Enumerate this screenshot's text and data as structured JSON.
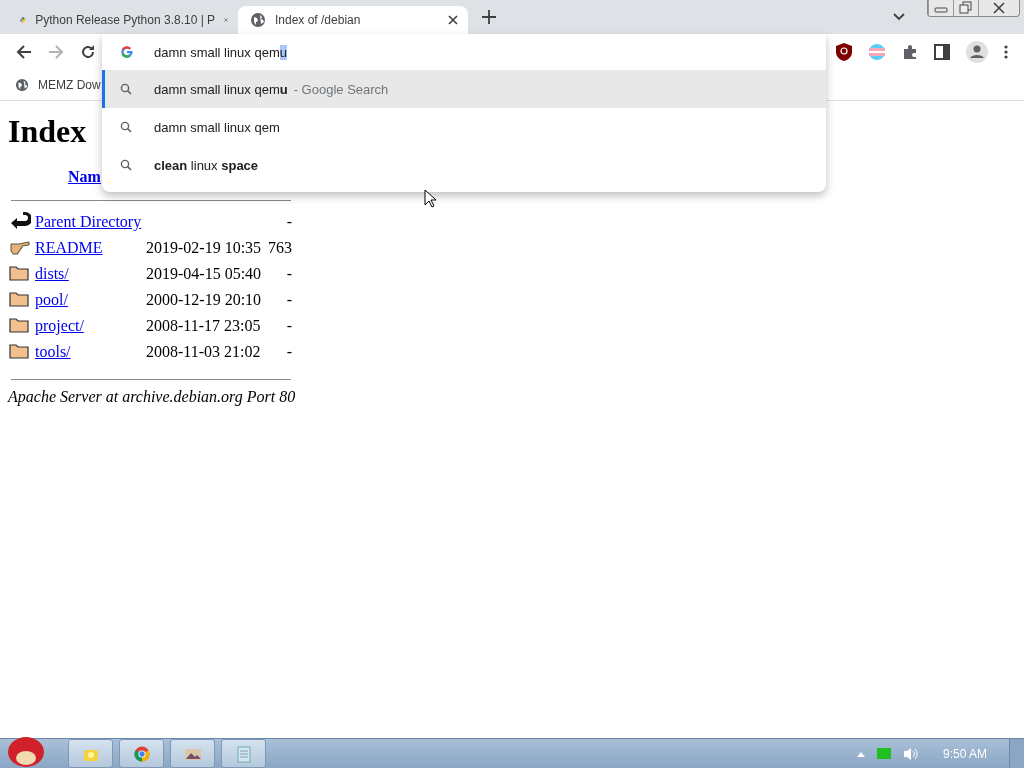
{
  "tabs": [
    {
      "title": "Python Release Python 3.8.10 | P",
      "kind": "python",
      "selected": false
    },
    {
      "title": "Index of /debian",
      "kind": "globe",
      "selected": true
    }
  ],
  "omnibox": {
    "value": "damn small linux qem",
    "autocomplete": "u"
  },
  "suggestions": [
    {
      "text": "damn small linux qem**u**",
      "suffix": "- Google Search",
      "selected": true
    },
    {
      "text": "damn small linux qem",
      "selected": false
    },
    {
      "text": "**clean** linux **space**",
      "selected": false
    }
  ],
  "bookmarks": [
    {
      "title": "MEMZ Dow"
    }
  ],
  "page": {
    "heading": "Index",
    "name_header": "Nam",
    "rows": [
      {
        "kind": "parent",
        "name": "Parent Directory",
        "date": "",
        "size": "-"
      },
      {
        "kind": "file",
        "name": "README",
        "date": "2019-02-19 10:35",
        "size": "763"
      },
      {
        "kind": "folder",
        "name": "dists/",
        "date": "2019-04-15 05:40",
        "size": "-"
      },
      {
        "kind": "folder",
        "name": "pool/",
        "date": "2000-12-19 20:10",
        "size": "-"
      },
      {
        "kind": "folder",
        "name": "project/",
        "date": "2008-11-17 23:05",
        "size": "-"
      },
      {
        "kind": "folder",
        "name": "tools/",
        "date": "2008-11-03 21:02",
        "size": "-"
      }
    ],
    "footer": "Apache Server at archive.debian.org Port 80"
  },
  "taskbar": {
    "apps": [
      {
        "kind": "notes"
      },
      {
        "kind": "chrome"
      },
      {
        "kind": "photo"
      },
      {
        "kind": "notepad"
      }
    ],
    "clock": "9:50 AM"
  }
}
